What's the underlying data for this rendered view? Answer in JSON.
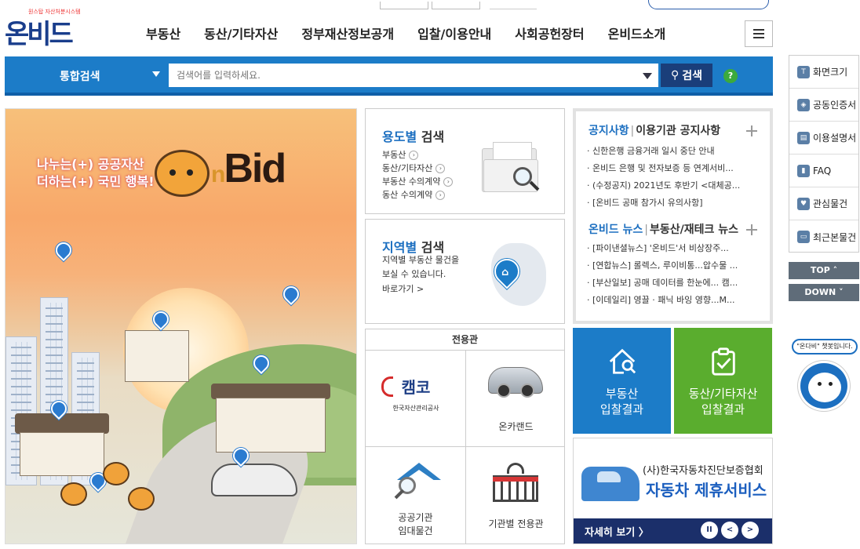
{
  "header": {
    "logo_text": "온비드",
    "logo_subtext": "원스탑 자산처분시스템",
    "nav": [
      "부동산",
      "동산/기타자산",
      "정부재산정보공개",
      "입찰/이용안내",
      "사회공헌장터",
      "온비드소개"
    ],
    "menu_icon": "hamburger-icon"
  },
  "search": {
    "category": "통합검색",
    "placeholder": "검색어를 입력하세요.",
    "button_label": "검색",
    "help_label": "?"
  },
  "banner": {
    "slogan_line1": "나누는(+) 공공자산",
    "slogan_line2": "더하는(+) 국민 행복!",
    "brand": "Bid",
    "brand_prefix": "n"
  },
  "usage_search": {
    "title_highlight": "용도별",
    "title_rest": "검색",
    "links": [
      "부동산",
      "동산/기타자산",
      "부동산 수의계약",
      "동산 수의계약"
    ]
  },
  "region_search": {
    "title_highlight": "지역별",
    "title_rest": "검색",
    "desc_line1": "지역별 부동산 물건을",
    "desc_line2": "보실 수 있습니다.",
    "more": "바로가기 >"
  },
  "dedicated": {
    "title": "전용관",
    "kamco_logo": "캠코",
    "kamco_name": "한국자산관리공사",
    "oncarland": "온카랜드",
    "public_rental_line1": "공공기관",
    "public_rental_line2": "임대물건",
    "agency": "기관별 전용관"
  },
  "notices": {
    "tab1": "공지사항",
    "tab2": "이용기관 공지사항",
    "items": [
      "· 신한은행 금융거래 일시 중단 안내",
      "· 온비드 은행 및 전자보증 등 연계서비...",
      "· (수정공지) 2021년도 후반기 <대체공...",
      "· [온비드 공매 참가시 유의사항]"
    ],
    "news_tab1": "온비드 뉴스",
    "news_tab2": "부동산/재테크 뉴스",
    "news": [
      "· [파이낸셜뉴스] '온비드'서 비상장주...",
      "· [연합뉴스] 롤렉스, 루이비통...압수물 ...",
      "· [부산일보] 공매 데이터를 한눈에... 캠...",
      "· [이데일리] 영끌 · 패닉 바잉 영향...M..."
    ]
  },
  "tiles": {
    "real_estate_line1": "부동산",
    "real_estate_line2": "입찰결과",
    "movable_line1": "동산/기타자산",
    "movable_line2": "입찰결과"
  },
  "ad": {
    "org": "(사)한국자동차진단보증협회",
    "service": "자동차 제휴서비스",
    "more": "자세히 보기 〉",
    "pause": "II",
    "prev": "<",
    "next": ">"
  },
  "quick": {
    "items": [
      "화면크기",
      "공동인증서",
      "이용설명서",
      "FAQ",
      "관심물건",
      "최근본물건"
    ],
    "top": "TOP ˄",
    "down": "DOWN ˅",
    "chatbot_bubble": "\"온다비\" 챗봇입니다."
  },
  "colors": {
    "primary_blue": "#1c7cc8",
    "navy": "#1a3e7a",
    "green": "#5aad2e",
    "logo_blue": "#1a3e8c"
  }
}
